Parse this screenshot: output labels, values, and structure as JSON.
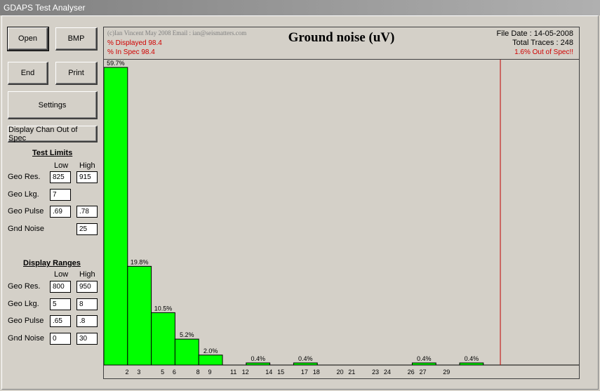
{
  "window": {
    "title": "GDAPS Test Analyser"
  },
  "buttons": {
    "open": "Open",
    "bmp": "BMP",
    "end": "End",
    "print": "Print",
    "settings": "Settings",
    "display_chan": "Display Chan Out of Spec"
  },
  "test_limits": {
    "heading": "Test Limits",
    "low_label": "Low",
    "high_label": "High",
    "geo_res": {
      "label": "Geo Res.",
      "low": "825",
      "high": "915"
    },
    "geo_lkg": {
      "label": "Geo Lkg.",
      "low": "7"
    },
    "geo_pulse": {
      "label": "Geo Pulse",
      "low": ".69",
      "high": ".78"
    },
    "gnd_noise": {
      "label": "Gnd Noise",
      "high": "25"
    }
  },
  "display_ranges": {
    "heading": "Display Ranges",
    "low_label": "Low",
    "high_label": "High",
    "geo_res": {
      "label": "Geo Res.",
      "low": "800",
      "high": "950"
    },
    "geo_lkg": {
      "label": "Geo Lkg.",
      "low": "5",
      "high": "8"
    },
    "geo_pulse": {
      "label": "Geo Pulse",
      "low": ".65",
      "high": ".8"
    },
    "gnd_noise": {
      "label": "Gnd Noise",
      "low": "0",
      "high": "30"
    }
  },
  "chart_header": {
    "copyright": "(c)Ian Vincent May 2008 Email : ian@seismatters.com",
    "displayed": "% Displayed 98.4",
    "in_spec": "% In Spec 98.4",
    "title": "Ground noise (uV)",
    "file_date": "File Date : 14-05-2008",
    "total_traces": "Total Traces : 248",
    "out_of_spec": "1.6% Out of Spec!!"
  },
  "colors": {
    "bar": "#00ff00",
    "limit_line": "#c00000",
    "warning_text": "#d00000"
  },
  "chart_data": {
    "type": "bar",
    "title": "Ground noise (uV)",
    "x_range": [
      0,
      30
    ],
    "y_range_percent": [
      0,
      60
    ],
    "bins": [
      {
        "from": 0,
        "to": 2,
        "value": 59.7,
        "label": "59.7%"
      },
      {
        "from": 2,
        "to": 4,
        "value": 19.8,
        "label": "19.8%"
      },
      {
        "from": 4,
        "to": 6,
        "value": 10.5,
        "label": "10.5%"
      },
      {
        "from": 6,
        "to": 8,
        "value": 5.2,
        "label": "5.2%"
      },
      {
        "from": 8,
        "to": 10,
        "value": 2.0,
        "label": "2.0%"
      },
      {
        "from": 12,
        "to": 14,
        "value": 0.4,
        "label": "0.4%"
      },
      {
        "from": 16,
        "to": 18,
        "value": 0.4,
        "label": "0.4%"
      },
      {
        "from": 26,
        "to": 28,
        "value": 0.4,
        "label": "0.4%"
      },
      {
        "from": 30,
        "to": 32,
        "value": 0.4,
        "label": "0.4%"
      }
    ],
    "tick_labels": [
      "2",
      "3",
      "5",
      "6",
      "8",
      "9",
      "11",
      "12",
      "14",
      "15",
      "17",
      "18",
      "20",
      "21",
      "23",
      "24",
      "26",
      "27",
      "29"
    ],
    "limit_line_x": 25
  }
}
